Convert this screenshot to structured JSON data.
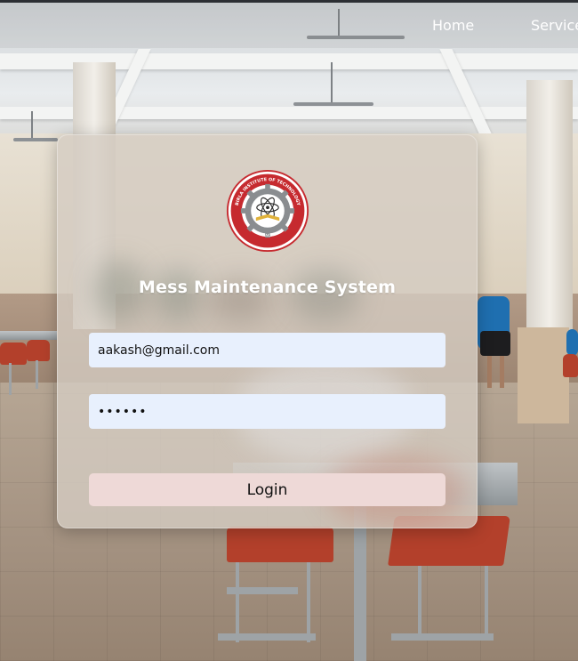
{
  "nav": {
    "links": [
      "Home",
      "Service"
    ]
  },
  "login": {
    "logo": {
      "ring_text": "बिरला प्रौद्योगिकी संस्थान • BIRLA INSTITUTE OF TECHNOLOGY",
      "motto": "तेजस्वि नावधीतमस्तु",
      "city": "RANCHI"
    },
    "title": "Mess Maintenance System",
    "email_value": "aakash@gmail.com",
    "password_value": "123456",
    "login_label": "Login"
  },
  "colors": {
    "input_bg": "#e8f0fd",
    "button_bg": "#eed9d7",
    "logo_red": "#c62a2f"
  }
}
